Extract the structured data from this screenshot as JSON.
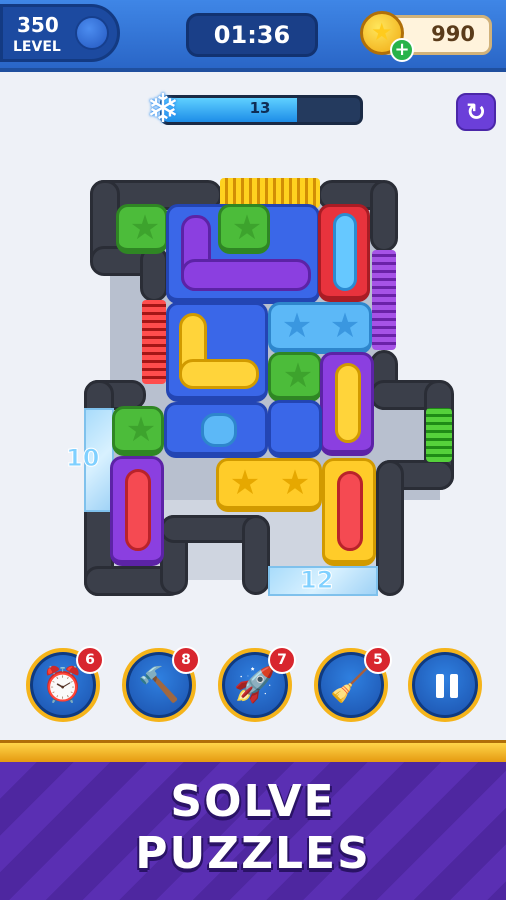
{
  "header": {
    "level_number": "350",
    "level_label": "LEVEL",
    "timer": "01:36",
    "coins": "990",
    "coin_add_icon": "+"
  },
  "freeze": {
    "value": "13",
    "progress": 0.68,
    "icon": "snowflake-icon",
    "restart_icon": "restart-icon"
  },
  "board": {
    "ice_left_count": "10",
    "ice_bottom_count": "12",
    "colors": {
      "blue": "#3a67e8",
      "purple": "#8b3fe0",
      "green": "#4cbc3a",
      "yellow": "#ffcc29",
      "red": "#e8333d",
      "sky": "#5cb8f7",
      "wall": "#3b3f4a"
    }
  },
  "boosters": [
    {
      "name": "alarm-clock-icon",
      "count": "6"
    },
    {
      "name": "hammer-icon",
      "count": "8"
    },
    {
      "name": "rocket-icon",
      "count": "7"
    },
    {
      "name": "vacuum-icon",
      "count": "5"
    }
  ],
  "pause_icon": "pause-icon",
  "banner": {
    "line1": "SOLVE",
    "line2": "PUZZLES",
    "accent": "#5a2fb3"
  }
}
